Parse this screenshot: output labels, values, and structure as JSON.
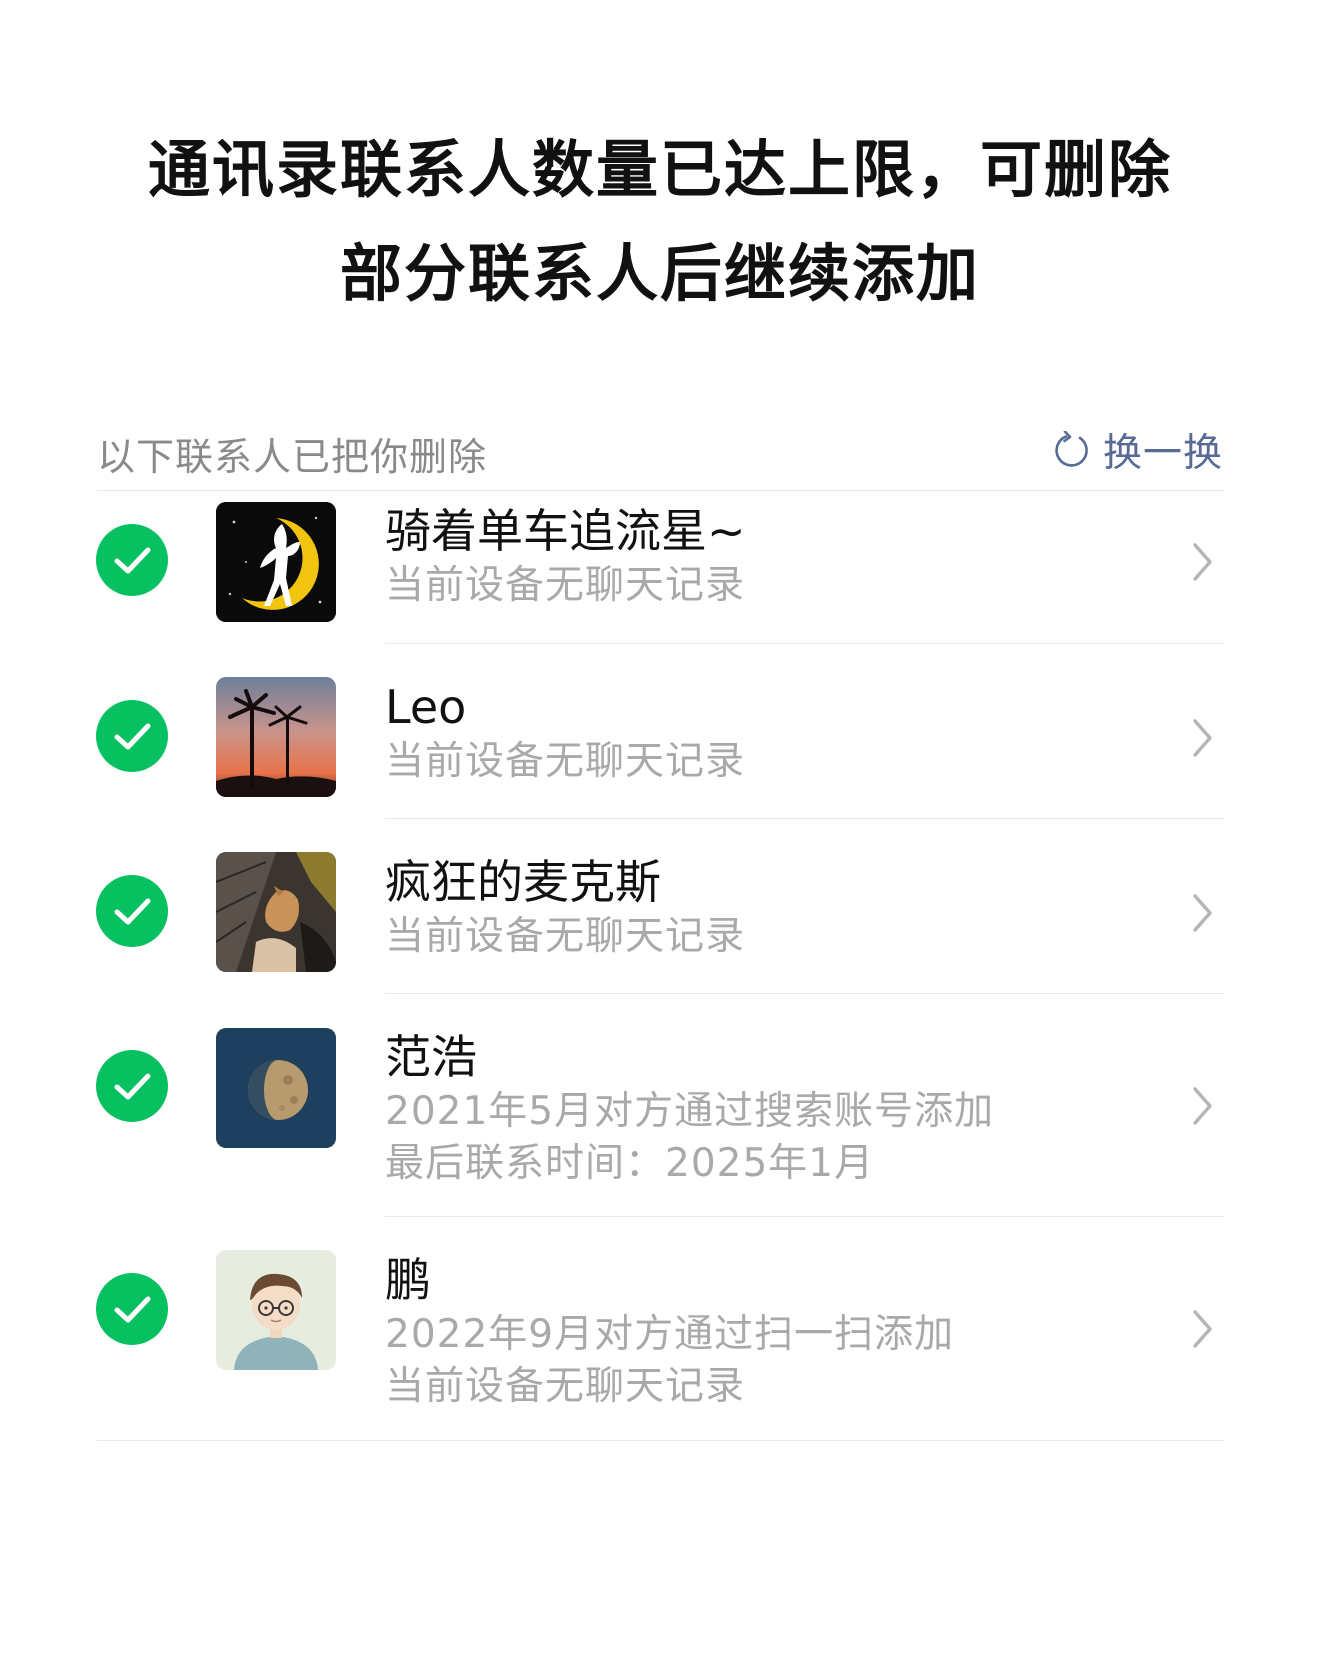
{
  "title": {
    "line1": "通讯录联系人数量已达上限，可删除",
    "line2": "部分联系人后继续添加"
  },
  "section": {
    "label": "以下联系人已把你删除",
    "refresh_label": "换一换",
    "refresh_icon": "refresh-icon"
  },
  "colors": {
    "check": "#07c160",
    "link": "#576b95",
    "secondary_text": "#a9a9a9"
  },
  "contacts": [
    {
      "name": "骑着单车追流星~",
      "lines": [
        "当前设备无聊天记录"
      ],
      "selected": true,
      "avatar": "sailor-moon-silhouette"
    },
    {
      "name": "Leo",
      "lines": [
        "当前设备无聊天记录"
      ],
      "selected": true,
      "avatar": "palm-trees-sunset"
    },
    {
      "name": "疯狂的麦克斯",
      "lines": [
        "当前设备无聊天记录"
      ],
      "selected": true,
      "avatar": "cat-photo"
    },
    {
      "name": "范浩",
      "lines": [
        "2021年5月对方通过搜索账号添加",
        "最后联系时间：2025年1月"
      ],
      "selected": true,
      "avatar": "half-moon"
    },
    {
      "name": "鹏",
      "lines": [
        "2022年9月对方通过扫一扫添加",
        "当前设备无聊天记录"
      ],
      "selected": true,
      "avatar": "cartoon-boy-glasses"
    }
  ]
}
